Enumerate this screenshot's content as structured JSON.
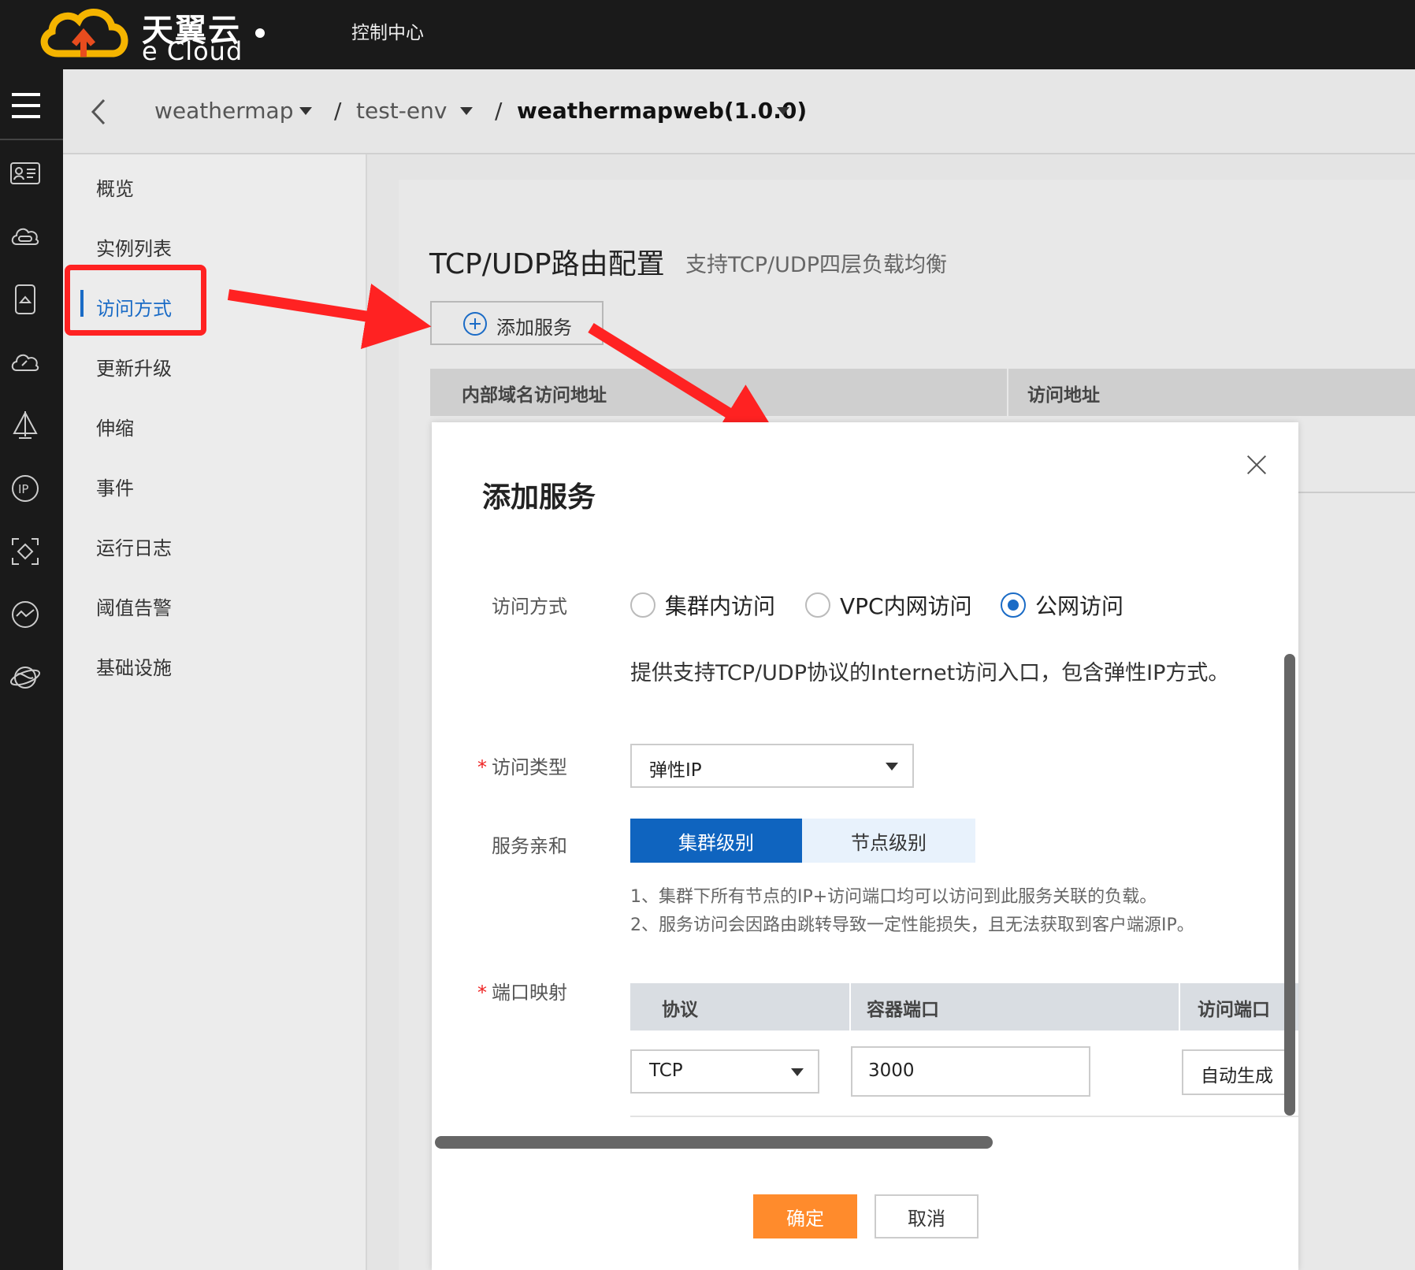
{
  "app": {
    "brand_cn": "天翼云",
    "brand_en": "e Cloud",
    "console_title": "控制中心"
  },
  "breadcrumb": {
    "items": [
      {
        "label": "weathermap"
      },
      {
        "label": "test-env"
      },
      {
        "label": "weathermapweb(1.0.0)"
      }
    ],
    "separator": "/"
  },
  "rail_icons": [
    "menu-icon",
    "id-card-icon",
    "cloud-disk-icon",
    "mobile-icon",
    "cloud-icon",
    "sail-icon",
    "ip-icon",
    "diamond-scan-icon",
    "monitor-icon",
    "globe-icon"
  ],
  "leftnav": {
    "items": [
      {
        "label": "概览"
      },
      {
        "label": "实例列表"
      },
      {
        "label": "访问方式"
      },
      {
        "label": "更新升级"
      },
      {
        "label": "伸缩"
      },
      {
        "label": "事件"
      },
      {
        "label": "运行日志"
      },
      {
        "label": "阈值告警"
      },
      {
        "label": "基础设施"
      }
    ],
    "active": "访问方式"
  },
  "main": {
    "title": "TCP/UDP路由配置",
    "subtitle": "支持TCP/UDP四层负载均衡",
    "add_button": "添加服务",
    "table_columns": [
      "内部域名访问地址",
      "访问地址"
    ]
  },
  "modal": {
    "title": "添加服务",
    "access_label": "访问方式",
    "access_options": [
      {
        "label": "集群内访问",
        "selected": false
      },
      {
        "label": "VPC内网访问",
        "selected": false
      },
      {
        "label": "公网访问",
        "selected": true
      }
    ],
    "access_desc": "提供支持TCP/UDP协议的Internet访问入口，包含弹性IP方式。",
    "type_label": "访问类型",
    "type_value": "弹性IP",
    "affinity_label": "服务亲和",
    "affinity_options": [
      {
        "label": "集群级别",
        "selected": true
      },
      {
        "label": "节点级别",
        "selected": false
      }
    ],
    "affinity_hints": [
      "1、集群下所有节点的IP+访问端口均可以访问到此服务关联的负载。",
      "2、服务访问会因路由跳转导致一定性能损失，且无法获取到客户端源IP。"
    ],
    "port_label": "端口映射",
    "port_columns": [
      "协议",
      "容器端口",
      "访问端口"
    ],
    "port_row": {
      "protocol": "TCP",
      "container_port": "3000",
      "access_port_button": "自动生成"
    },
    "required_mark": "*",
    "confirm": "确定",
    "cancel": "取消"
  },
  "colors": {
    "accent": "#1a6bc6",
    "confirm": "#ff8b2c",
    "annotation": "#f22222"
  }
}
